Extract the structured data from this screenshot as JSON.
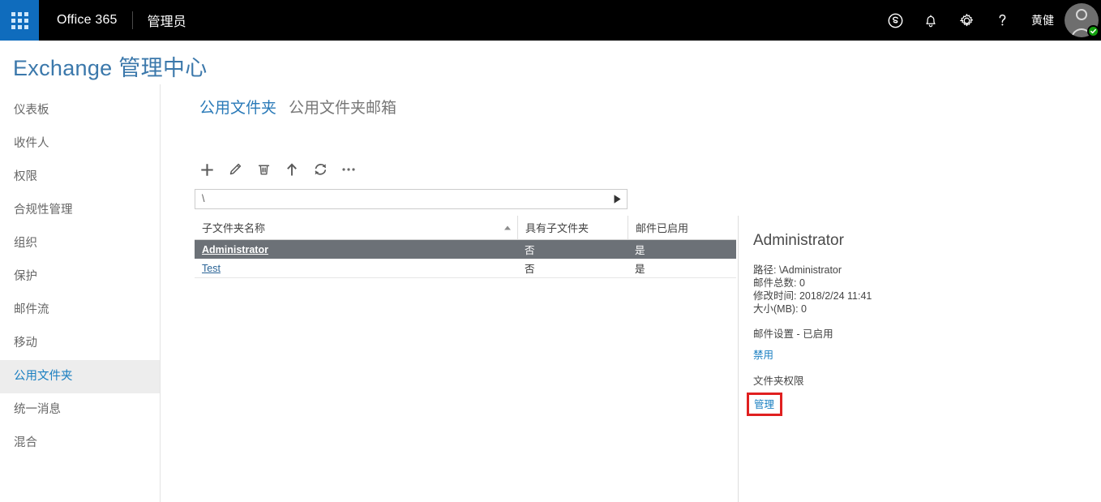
{
  "suite": {
    "waffle_label": "app-launcher",
    "brand": "Office 365",
    "app_name": "管理员",
    "icons": [
      {
        "name": "skype-icon",
        "label": "Skype"
      },
      {
        "name": "notifications-bell-icon",
        "label": "通知"
      },
      {
        "name": "settings-gear-icon",
        "label": "设置"
      },
      {
        "name": "help-question-icon",
        "label": "帮助"
      }
    ],
    "user_name": "黄健",
    "presence": "available"
  },
  "eac": {
    "title": "Exchange 管理中心"
  },
  "sidebar": {
    "items": [
      {
        "label": "仪表板",
        "selected": false
      },
      {
        "label": "收件人",
        "selected": false
      },
      {
        "label": "权限",
        "selected": false
      },
      {
        "label": "合规性管理",
        "selected": false
      },
      {
        "label": "组织",
        "selected": false
      },
      {
        "label": "保护",
        "selected": false
      },
      {
        "label": "邮件流",
        "selected": false
      },
      {
        "label": "移动",
        "selected": false
      },
      {
        "label": "公用文件夹",
        "selected": true
      },
      {
        "label": "统一消息",
        "selected": false
      },
      {
        "label": "混合",
        "selected": false
      }
    ]
  },
  "tabs": [
    {
      "label": "公用文件夹",
      "active": true
    },
    {
      "label": "公用文件夹邮箱",
      "active": false
    }
  ],
  "toolbar": {
    "buttons": [
      {
        "name": "add-icon",
        "label": "新建"
      },
      {
        "name": "edit-pencil-icon",
        "label": "编辑"
      },
      {
        "name": "delete-trash-icon",
        "label": "删除"
      },
      {
        "name": "move-up-arrow-icon",
        "label": "上移"
      },
      {
        "name": "refresh-icon",
        "label": "刷新"
      },
      {
        "name": "more-ellipsis-icon",
        "label": "更多"
      }
    ]
  },
  "path_bar": {
    "value": "\\",
    "placeholder": "\\",
    "go_icon": "play-triangle-icon"
  },
  "grid": {
    "columns": [
      {
        "label": "子文件夹名称",
        "sorted": "asc"
      },
      {
        "label": "具有子文件夹",
        "sorted": ""
      },
      {
        "label": "邮件已启用",
        "sorted": ""
      }
    ],
    "rows": [
      {
        "name": "Administrator",
        "has_subfolders": "否",
        "mail_enabled": "是",
        "selected": true
      },
      {
        "name": "Test",
        "has_subfolders": "否",
        "mail_enabled": "是",
        "selected": false
      }
    ]
  },
  "details": {
    "title": "Administrator",
    "path_line": "路径: \\Administrator",
    "total_items_line": "邮件总数: 0",
    "modified_line": "修改时间: 2018/2/24 11:41",
    "size_line": "大小(MB): 0",
    "mail_settings_label": "邮件设置 - 已启用",
    "mail_settings_link": "禁用",
    "folder_permission_label": "文件夹权限",
    "folder_permission_link": "管理"
  },
  "colors": {
    "suite_bar": "#000000",
    "waffle": "#0f6cbd",
    "accent_blue": "#1a7fc1",
    "title_blue": "#3b78ab",
    "selected_row": "#6c7177",
    "highlight_red": "#e02020",
    "presence_green": "#13a10e"
  }
}
